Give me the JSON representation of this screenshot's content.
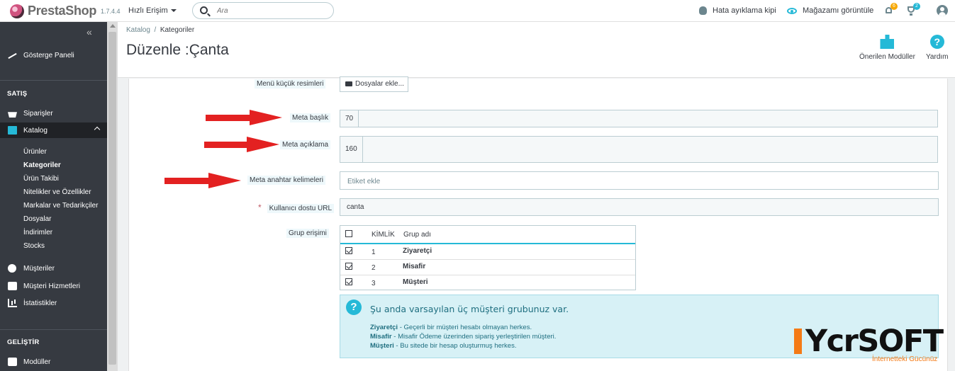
{
  "header": {
    "logo_text": "PrestaShop",
    "version": "1.7.4.4",
    "quick_access": "Hızlı Erişim",
    "search_placeholder": "Ara",
    "debug_mode": "Hata ayıklama kipi",
    "view_store": "Mağazamı görüntüle",
    "notif_count": "6",
    "trophy_count": "2",
    "notif_badge_color": "#f7a800",
    "trophy_badge_color": "#25b9d7"
  },
  "sidebar": {
    "dashboard": "Gösterge Paneli",
    "section_sell": "SATIŞ",
    "orders": "Siparişler",
    "catalog": "Katalog",
    "catalog_sub": [
      "Ürünler",
      "Kategoriler",
      "Ürün Takibi",
      "Nitelikler ve Özellikler",
      "Markalar ve Tedarikçiler",
      "Dosyalar",
      "İndirimler",
      "Stocks"
    ],
    "customers": "Müşteriler",
    "customer_service": "Müşteri Hizmetleri",
    "stats": "İstatistikler",
    "section_improve": "GELİŞTİR",
    "modules": "Modüller"
  },
  "page": {
    "breadcrumb_parent": "Katalog",
    "breadcrumb_sep": "/",
    "breadcrumb_current": "Kategoriler",
    "title": "Düzenle :Çanta",
    "tool_modules": "Önerilen Modüller",
    "tool_help": "Yardım"
  },
  "form": {
    "menu_thumb_label": "Menü küçük resimleri",
    "add_files": "Dosyalar ekle...",
    "meta_title_label": "Meta başlık",
    "meta_title_count": "70",
    "meta_desc_label": "Meta açıklama",
    "meta_desc_count": "160",
    "meta_keywords_label": "Meta anahtar kelimeleri",
    "meta_keywords_placeholder": "Etiket ekle",
    "friendly_url_label": "Kullanıcı dostu URL",
    "friendly_url_value": "canta",
    "group_access_label": "Grup erişimi"
  },
  "group_table": {
    "col_id": "KİMLİK",
    "col_name": "Grup adı",
    "rows": [
      {
        "id": "1",
        "name": "Ziyaretçi"
      },
      {
        "id": "2",
        "name": "Misafir"
      },
      {
        "id": "3",
        "name": "Müşteri"
      }
    ]
  },
  "info_box": {
    "title": "Şu anda varsayılan üç müşteri grubunuz var.",
    "lines": [
      {
        "term": "Ziyaretçi",
        "desc": " - Geçerli bir müşteri hesabı olmayan herkes."
      },
      {
        "term": "Misafir",
        "desc": " - Misafir Ödeme üzerinden sipariş yerleştirilen müşteri."
      },
      {
        "term": "Müşteri",
        "desc": " - Bu sitede bir hesap oluşturmuş herkes."
      }
    ]
  },
  "watermark": {
    "brand": "YcrSOFT",
    "tagline": "İnternetteki Gücünüz"
  }
}
